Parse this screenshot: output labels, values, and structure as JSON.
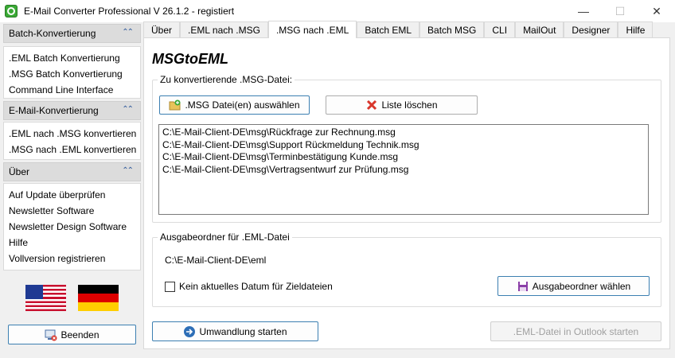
{
  "window": {
    "title": "E-Mail Converter Professional V 26.1.2 - registiert",
    "minimize": "—",
    "maximize": "☐",
    "close": "✕"
  },
  "sidebar": {
    "sections": [
      {
        "title": "Batch-Konvertierung",
        "items": [
          ".EML Batch Konvertierung",
          ".MSG Batch Konvertierung",
          "Command Line Interface"
        ]
      },
      {
        "title": "E-Mail-Konvertierung",
        "items": [
          ".EML nach .MSG konvertieren",
          ".MSG nach .EML konvertieren"
        ]
      },
      {
        "title": "Über",
        "items": [
          "Auf Update überprüfen",
          "Newsletter Software",
          "Newsletter Design Software",
          "Hilfe",
          "Vollversion registrieren"
        ]
      }
    ],
    "exit_label": "Beenden"
  },
  "tabs": [
    "Über",
    ".EML nach .MSG",
    ".MSG nach .EML",
    "Batch EML",
    "Batch MSG",
    "CLI",
    "MailOut",
    "Designer",
    "Hilfe"
  ],
  "active_tab": 2,
  "main": {
    "heading": "MSGtoEML",
    "input_group_label": "Zu konvertierende  .MSG-Datei:",
    "select_files_label": ".MSG Datei(en) auswählen",
    "clear_list_label": "Liste löschen",
    "files": [
      "C:\\E-Mail-Client-DE\\msg\\Rückfrage zur Rechnung.msg",
      "C:\\E-Mail-Client-DE\\msg\\Support Rückmeldung Technik.msg",
      "C:\\E-Mail-Client-DE\\msg\\Terminbestätigung Kunde.msg",
      "C:\\E-Mail-Client-DE\\msg\\Vertragsentwurf zur Prüfung.msg"
    ],
    "output_group_label": "Ausgabeordner für .EML-Datei",
    "output_path": "C:\\E-Mail-Client-DE\\eml",
    "no_date_label": "Kein aktuelles Datum für Zieldateien",
    "choose_output_label": "Ausgabeordner wählen",
    "start_label": "Umwandlung starten",
    "open_outlook_label": ".EML-Datei in Outlook starten"
  },
  "colors": {
    "accent_border": "#3c7fb1",
    "active_tab_bg": "#ffffff",
    "sidebar_header_bg": "#dcdcdc"
  }
}
